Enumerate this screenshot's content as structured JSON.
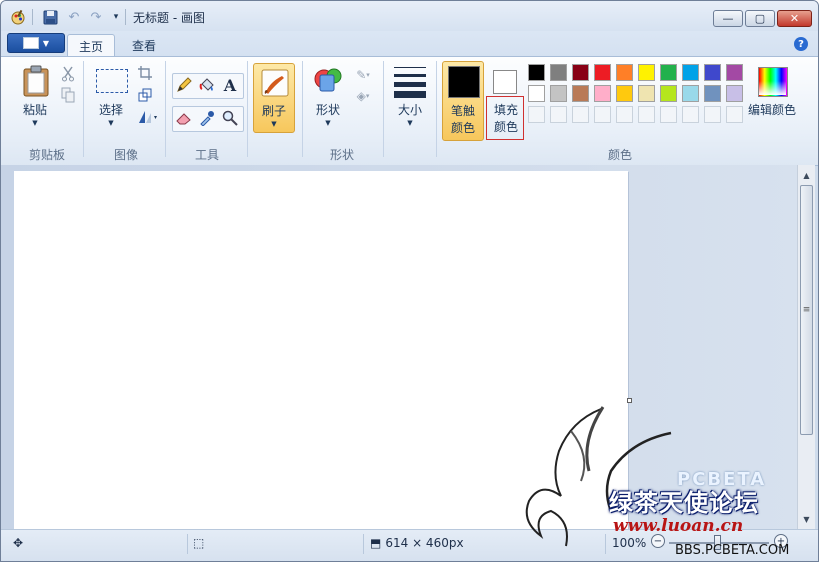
{
  "window": {
    "title": "无标题 - 画图",
    "minimize": "—",
    "maximize": "▢",
    "close": "✕"
  },
  "tabs": [
    {
      "label": "主页",
      "active": true
    },
    {
      "label": "查看",
      "active": false
    }
  ],
  "help": "?",
  "ribbon": {
    "clipboard": {
      "label": "剪贴板",
      "paste": "粘贴"
    },
    "image": {
      "label": "图像",
      "select": "选择"
    },
    "tools": {
      "label": "工具"
    },
    "brush": {
      "label": "刷子"
    },
    "shapes": {
      "label": "形状",
      "shapes_btn": "形状"
    },
    "size": {
      "label": "大小"
    },
    "colors": {
      "label": "颜色",
      "color1": {
        "line1": "笔触",
        "line2": "颜色",
        "value": "#000000"
      },
      "color2": {
        "line1": "填充",
        "line2": "颜色",
        "value": "#ffffff"
      },
      "edit": "编辑颜色",
      "palette_row1": [
        "#000000",
        "#7f7f7f",
        "#880015",
        "#ed1c24",
        "#ff7f27",
        "#fff200",
        "#22b14c",
        "#00a2e8",
        "#3f48cc",
        "#a349a4"
      ],
      "palette_row2": [
        "#ffffff",
        "#c3c3c3",
        "#b97a57",
        "#ffaec9",
        "#ffc90e",
        "#efe4b0",
        "#b5e61d",
        "#99d9ea",
        "#7092be",
        "#c8bfe7"
      ]
    }
  },
  "status": {
    "dimensions": "614 × 460px",
    "zoom": "100%"
  },
  "watermark": {
    "chinese": "绿茶天使论坛",
    "url": "www.luoan.cn",
    "logo": "PCBETA",
    "site": "BBS.PCBETA.COM"
  }
}
